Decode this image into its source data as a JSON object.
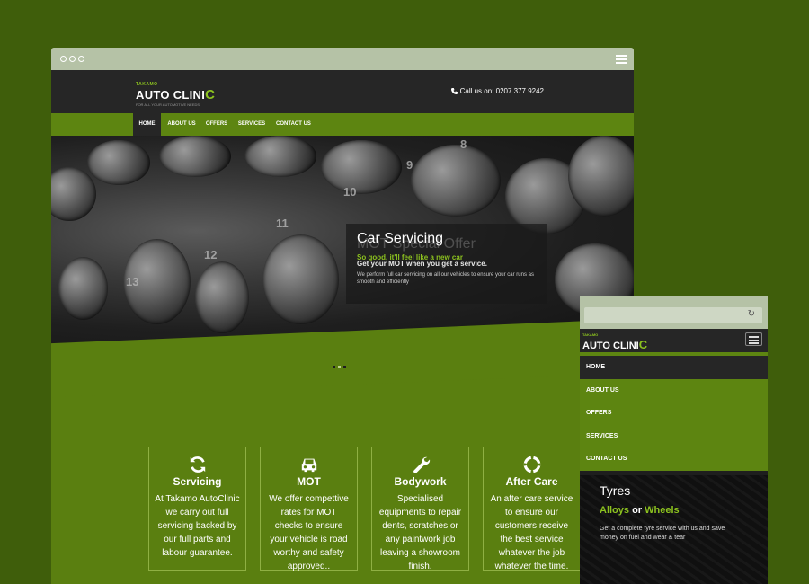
{
  "desktop": {
    "logo": {
      "small": "TAKAMO",
      "main": "AUTO CLINI",
      "c": "C",
      "tag": "FOR ALL YOUR AUTOMOTIVE NEEDS"
    },
    "phone": "Call us on: 0207 377 9242",
    "nav": [
      {
        "label": "HOME"
      },
      {
        "label": "ABOUT US"
      },
      {
        "label": "OFFERS"
      },
      {
        "label": "SERVICES"
      },
      {
        "label": "CONTACT US"
      }
    ],
    "hero": {
      "numbers": [
        "13",
        "12",
        "11",
        "10",
        "9",
        "8"
      ],
      "title": "Car Servicing",
      "ghost_title": "MOT Special Offer",
      "subtitle": "So good, it'll feel like a new car",
      "ghost_subtitle": "Get your MOT when you get a service.",
      "text": "We perform full car servicing on all our vehicles to ensure your car runs as smooth and efficiently"
    },
    "cards": [
      {
        "icon": "refresh-icon",
        "title": "Servicing",
        "text": "At Takamo AutoClinic we carry out full servicing backed by our full parts and labour guarantee."
      },
      {
        "icon": "car-icon",
        "title": "MOT",
        "text": "We offer compettive rates for MOT checks to ensure your vehicle is road worthy and safety approved.."
      },
      {
        "icon": "wrench-icon",
        "title": "Bodywork",
        "text": "Specialised equipments to repair dents, scratches or any paintwork job leaving a showroom finish."
      },
      {
        "icon": "lifebuoy-icon",
        "title": "After Care",
        "text": "An after care service to ensure our customers receive the best service whatever the job whatever the time."
      }
    ]
  },
  "mobile": {
    "logo": {
      "small": "TAKAMO",
      "main": "AUTO CLINI",
      "c": "C"
    },
    "nav": [
      {
        "label": "HOME"
      },
      {
        "label": "ABOUT US"
      },
      {
        "label": "OFFERS"
      },
      {
        "label": "SERVICES"
      },
      {
        "label": "CONTACT US"
      }
    ],
    "hero": {
      "title": "Tyres",
      "sub_a": "Alloys",
      "sub_or": " or ",
      "sub_b": "Wheels",
      "text": "Get a complete tyre service with us and save money on fuel and wear & tear"
    }
  },
  "colors": {
    "accent": "#8cc21f",
    "green": "#5a7f10",
    "dark": "#262626",
    "background": "#3f5e0b"
  }
}
